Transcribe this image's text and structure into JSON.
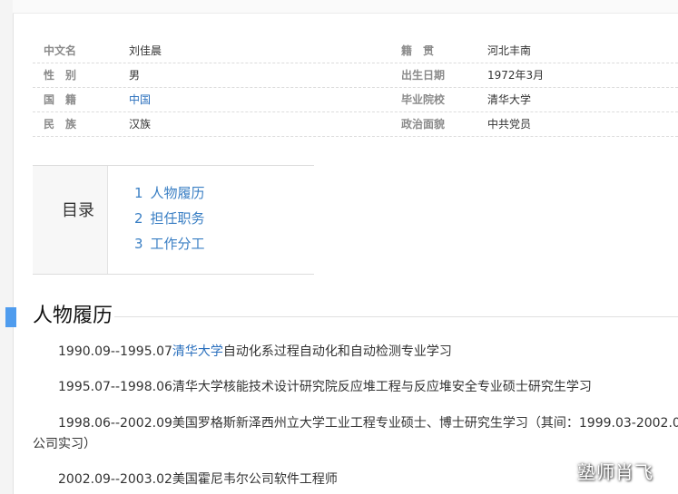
{
  "basic_info": {
    "rows": [
      {
        "label1": "中文名",
        "value1": "刘佳晨",
        "label2": "籍　贯",
        "value2": "河北丰南"
      },
      {
        "label1": "性　别",
        "value1": "男",
        "label2": "出生日期",
        "value2": "1972年3月"
      },
      {
        "label1": "国　籍",
        "value1": "中国",
        "label2": "毕业院校",
        "value2": "清华大学"
      },
      {
        "label1": "民　族",
        "value1": "汉族",
        "label2": "政治面貌",
        "value2": "中共党员"
      }
    ]
  },
  "toc": {
    "title": "目录",
    "items": [
      {
        "num": "1",
        "label": "人物履历"
      },
      {
        "num": "2",
        "label": "担任职务"
      },
      {
        "num": "3",
        "label": "工作分工"
      }
    ]
  },
  "section": {
    "title": "人物履历",
    "paragraphs": [
      {
        "prefix": "1990.09--1995.07",
        "link": "清华大学",
        "suffix": "自动化系过程自动化和自动检测专业学习"
      },
      {
        "text": "1995.07--1998.06清华大学核能技术设计研究院反应堆工程与反应堆安全专业硕士研究生学习"
      },
      {
        "text": "1998.06--2002.09美国罗格斯新泽西州立大学工业工程专业硕士、博士研究生学习（其间：1999.03-2002.09 美",
        "cont": "公司实习）"
      },
      {
        "text": "2002.09--2003.02美国霍尼韦尔公司软件工程师"
      }
    ]
  },
  "watermark": "塾师肖飞",
  "colors": {
    "accent_bar": "#4f9cee",
    "link": "#2a6fbd",
    "toc_link": "#3a7fc4"
  }
}
